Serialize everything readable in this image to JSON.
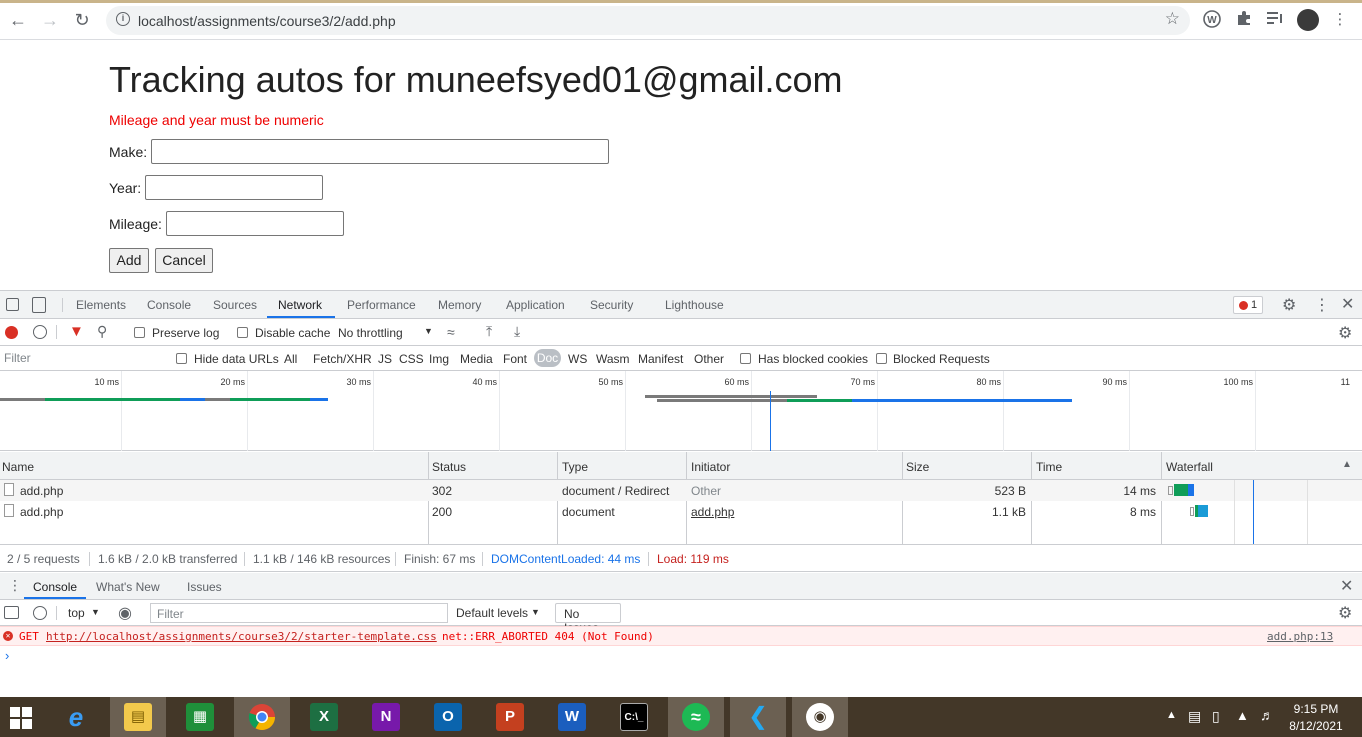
{
  "browser": {
    "url": "localhost/assignments/course3/2/add.php"
  },
  "page": {
    "title": "Tracking autos for muneefsyed01@gmail.com",
    "error": "Mileage and year must be numeric",
    "make_label": "Make:",
    "year_label": "Year:",
    "mileage_label": "Mileage:",
    "add_label": "Add",
    "cancel_label": "Cancel"
  },
  "devtools": {
    "tabs": [
      "Elements",
      "Console",
      "Sources",
      "Network",
      "Performance",
      "Memory",
      "Application",
      "Security",
      "Lighthouse"
    ],
    "active_tab": "Network",
    "error_count": "1",
    "toolbar": {
      "preserve_log": "Preserve log",
      "disable_cache": "Disable cache",
      "throttling": "No throttling"
    },
    "filter": {
      "placeholder": "Filter",
      "hide_data_urls": "Hide data URLs",
      "types": [
        "All",
        "Fetch/XHR",
        "JS",
        "CSS",
        "Img",
        "Media",
        "Font",
        "Doc",
        "WS",
        "Wasm",
        "Manifest",
        "Other"
      ],
      "active_type": "Doc",
      "blocked_cookies": "Has blocked cookies",
      "blocked_requests": "Blocked Requests"
    },
    "timeline_ticks": [
      "10 ms",
      "20 ms",
      "30 ms",
      "40 ms",
      "50 ms",
      "60 ms",
      "70 ms",
      "80 ms",
      "90 ms",
      "100 ms",
      "11"
    ],
    "table": {
      "columns": [
        "Name",
        "Status",
        "Type",
        "Initiator",
        "Size",
        "Time",
        "Waterfall"
      ],
      "rows": [
        {
          "name": "add.php",
          "status": "302",
          "type": "document / Redirect",
          "initiator": "Other",
          "size": "523 B",
          "time": "14 ms"
        },
        {
          "name": "add.php",
          "status": "200",
          "type": "document",
          "initiator": "add.php",
          "size": "1.1 kB",
          "time": "8 ms"
        }
      ]
    },
    "summary": {
      "requests": "2 / 5 requests",
      "transferred": "1.6 kB / 2.0 kB transferred",
      "resources": "1.1 kB / 146 kB resources",
      "finish": "Finish: 67 ms",
      "dom": "DOMContentLoaded: 44 ms",
      "load": "Load: 119 ms"
    },
    "drawer": {
      "tabs": [
        "Console",
        "What's New",
        "Issues"
      ],
      "context": "top",
      "filter_placeholder": "Filter",
      "levels": "Default levels",
      "issues": "No Issues",
      "error_method": "GET",
      "error_url": "http://localhost/assignments/course3/2/starter-template.css",
      "error_text": "net::ERR_ABORTED 404 (Not Found)",
      "error_source": "add.php:13",
      "prompt": "›"
    }
  },
  "taskbar": {
    "time": "9:15 PM",
    "date": "8/12/2021"
  }
}
